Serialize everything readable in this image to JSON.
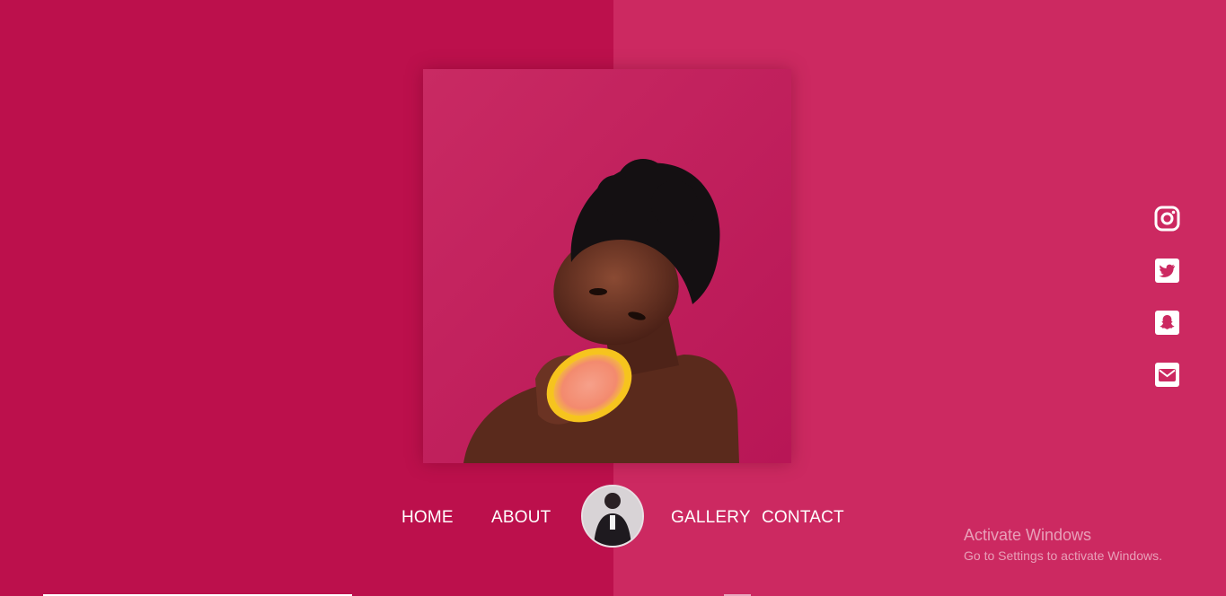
{
  "colors": {
    "left_panel": "#bc104c",
    "right_panel": "#cc2961",
    "text": "#ffffff"
  },
  "hero": {
    "image": "woman-with-grapefruit-photo"
  },
  "nav": {
    "home": "HOME",
    "about": "ABOUT",
    "avatar": "profile-avatar",
    "gallery": "GALLERY",
    "contact": "CONTACT"
  },
  "social": {
    "items": [
      {
        "icon": "instagram-icon"
      },
      {
        "icon": "twitter-icon"
      },
      {
        "icon": "snapchat-icon"
      },
      {
        "icon": "mail-icon"
      }
    ]
  },
  "watermark": {
    "title": "Activate Windows",
    "subtitle": "Go to Settings to activate Windows."
  }
}
